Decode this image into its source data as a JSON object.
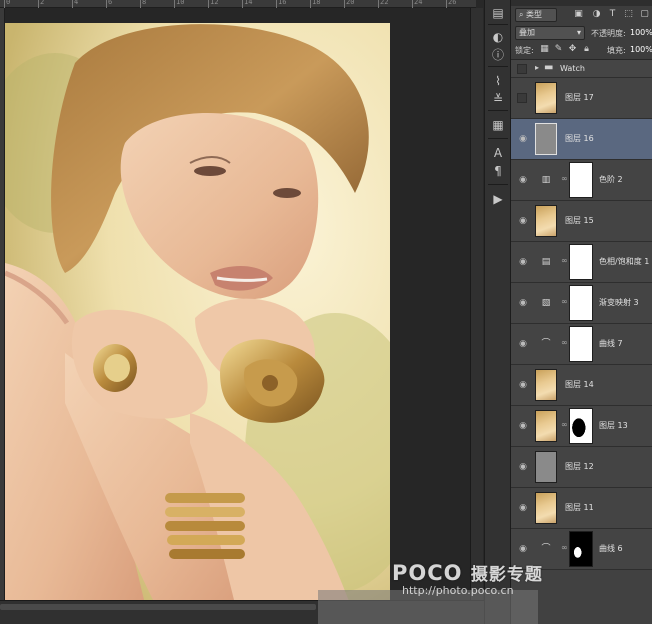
{
  "ruler": {
    "labels": [
      "0",
      "2",
      "4",
      "6",
      "8",
      "10",
      "12",
      "14",
      "16",
      "18",
      "20",
      "22",
      "24",
      "26"
    ]
  },
  "layers_panel": {
    "filter_label": "类型",
    "blend_mode": "叠加",
    "opacity_label": "不透明度:",
    "opacity_value": "100%",
    "lock_label": "锁定:",
    "fill_label": "填充:",
    "fill_value": "100%",
    "group": {
      "name": "Watch"
    },
    "layers": [
      {
        "name": "图层 17",
        "thumb": "photo",
        "visible": false
      },
      {
        "name": "图层 16",
        "thumb": "gray",
        "visible": true,
        "selected": true
      },
      {
        "name": "色阶 2",
        "thumb": "adjust-levels",
        "visible": true
      },
      {
        "name": "图层 15",
        "thumb": "photo",
        "visible": true
      },
      {
        "name": "色相/饱和度 1",
        "thumb": "adjust-hue",
        "visible": true
      },
      {
        "name": "渐变映射 3",
        "thumb": "adjust-gradient",
        "visible": true
      },
      {
        "name": "曲线 7",
        "thumb": "adjust-curves",
        "visible": true
      },
      {
        "name": "图层 14",
        "thumb": "photo",
        "visible": true
      },
      {
        "name": "图层 13",
        "thumb": "photo",
        "visible": true
      },
      {
        "name": "图层 12",
        "thumb": "gray",
        "visible": true
      },
      {
        "name": "图层 11",
        "thumb": "photo",
        "visible": true
      },
      {
        "name": "曲线 6",
        "thumb": "adjust-curves",
        "visible": true
      }
    ]
  },
  "watermark": {
    "brand": "POCO",
    "title": "摄影专题",
    "url": "http://photo.poco.cn"
  },
  "colors": {
    "panel_bg": "#3d3d3d",
    "selected_row": "#5a6880",
    "canvas_bg": "#262626"
  }
}
